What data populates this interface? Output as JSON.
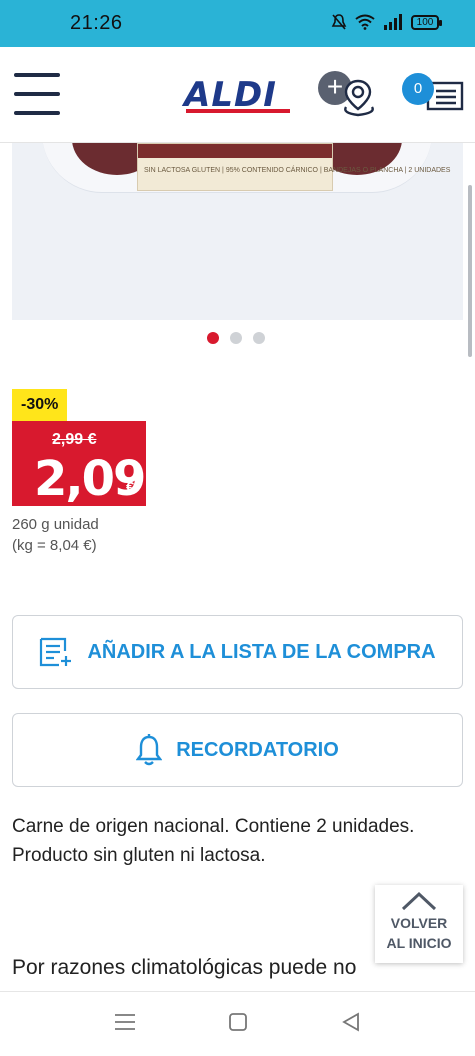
{
  "status_bar": {
    "time": "21:26",
    "battery": "100",
    "icons": [
      "mute-bell-icon",
      "wifi-icon",
      "signal-icon",
      "battery-icon"
    ]
  },
  "header": {
    "logo": "ALDI",
    "store_icon": "add-store-location-icon",
    "list_count": "0",
    "menu_icon": "hamburger-menu-icon",
    "list_icon": "shopping-list-icon"
  },
  "product_image": {
    "pack_label": "SIN LACTOSA GLUTEN | 95% CONTENIDO CÁRNICO | BANDEJAS O PLANCHA | 2 UNIDADES",
    "carousel_dots": 3,
    "active_dot": 0
  },
  "price": {
    "discount": "-30%",
    "old_price": "2,99 €",
    "new_price": "2,09",
    "currency": "€",
    "unit_line1": "260 g unidad",
    "unit_line2": "(kg = 8,04 €)"
  },
  "actions": {
    "add_to_list": "AÑADIR A LA LISTA DE LA COMPRA",
    "reminder": "RECORDATORIO"
  },
  "description": {
    "text": "Carne de origen nacional. Contiene 2 unidades. Producto sin gluten ni lactosa.",
    "text2": "Por razones climatológicas puede no"
  },
  "back_to_top": {
    "line1": "VOLVER",
    "line2": "AL INICIO"
  },
  "colors": {
    "status_bar": "#2ab3d6",
    "brand_blue": "#1e3a8a",
    "brand_red": "#d8192e",
    "discount_yellow": "#ffe51a",
    "action_blue": "#1e8fd8"
  }
}
